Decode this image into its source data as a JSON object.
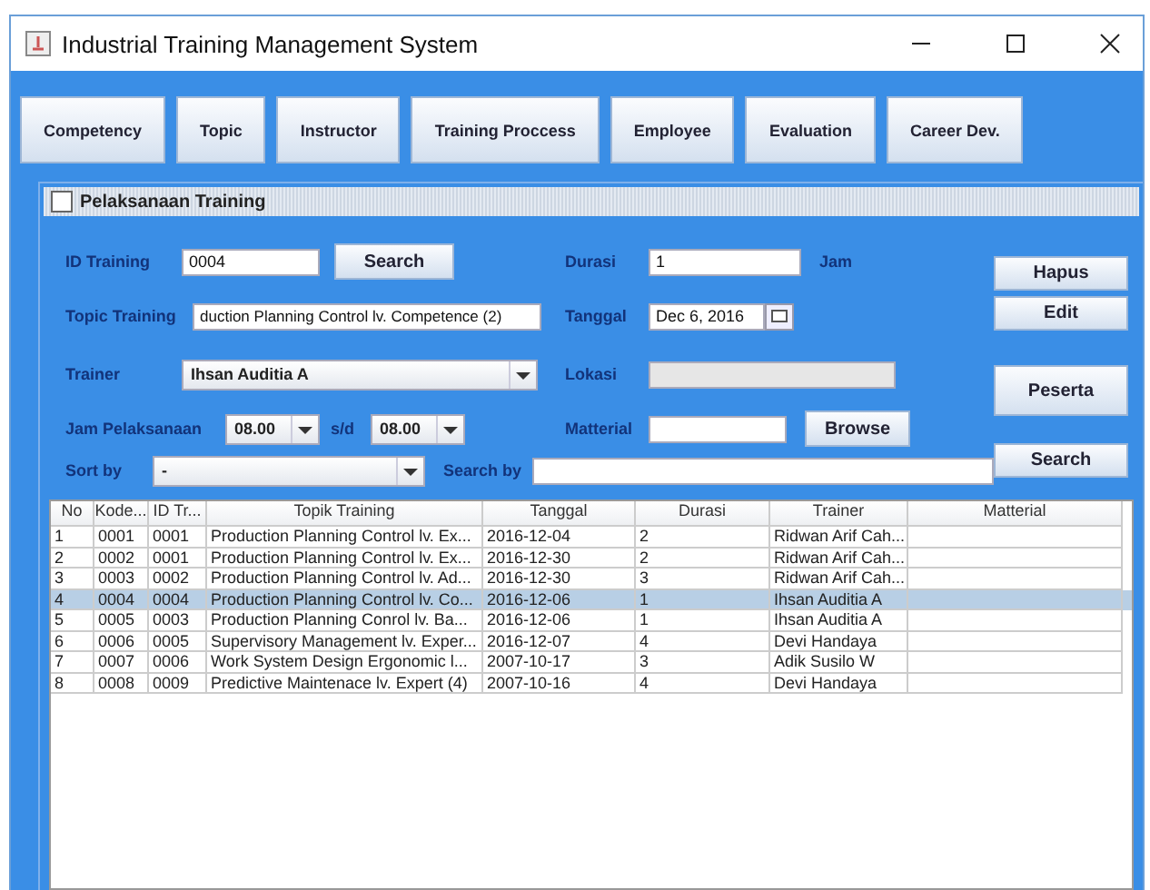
{
  "window": {
    "title": "Industrial Training Management System"
  },
  "nav_buttons": [
    "Competency",
    "Topic",
    "Instructor",
    "Training Proccess",
    "Employee",
    "Evaluation",
    "Career Dev."
  ],
  "frame": {
    "title": "Pelaksanaan Training"
  },
  "form": {
    "id_training": {
      "label": "ID Training",
      "value": "0004",
      "button": "Search"
    },
    "durasi": {
      "label": "Durasi",
      "value": "1",
      "unit": "Jam"
    },
    "topic": {
      "label": "Topic Training",
      "value": "duction Planning Control lv. Competence (2)"
    },
    "tanggal": {
      "label": "Tanggal",
      "value": "Dec 6, 2016"
    },
    "trainer": {
      "label": "Trainer",
      "value": "Ihsan Auditia A"
    },
    "lokasi": {
      "label": "Lokasi",
      "disabled": true
    },
    "jam": {
      "label": "Jam Pelaksanaan",
      "from": "08.00",
      "sep": "s/d",
      "to": "08.00"
    },
    "matterial": {
      "label": "Matterial",
      "button": "Browse"
    },
    "sort_by": {
      "label": "Sort by",
      "value": "-"
    },
    "search_by": {
      "label": "Search by"
    }
  },
  "side_buttons": [
    "Hapus",
    "Edit",
    "Peserta",
    "Search"
  ],
  "table": {
    "columns": [
      "No",
      "Kode...",
      "ID Tr...",
      "Topik Training",
      "Tanggal",
      "Durasi",
      "Trainer",
      "Matterial"
    ],
    "rows": [
      {
        "cells": [
          "1",
          "0001",
          "0001",
          "Production Planning Control lv. Ex...",
          "2016-12-04",
          "2",
          "Ridwan Arif Cah...",
          ""
        ],
        "selected": false
      },
      {
        "cells": [
          "2",
          "0002",
          "0001",
          "Production Planning Control lv. Ex...",
          "2016-12-30",
          "2",
          "Ridwan Arif Cah...",
          ""
        ],
        "selected": false
      },
      {
        "cells": [
          "3",
          "0003",
          "0002",
          "Production Planning Control lv. Ad...",
          "2016-12-30",
          "3",
          "Ridwan Arif Cah...",
          ""
        ],
        "selected": false
      },
      {
        "cells": [
          "4",
          "0004",
          "0004",
          "Production Planning Control lv. Co...",
          "2016-12-06",
          "1",
          "Ihsan Auditia A",
          ""
        ],
        "selected": true
      },
      {
        "cells": [
          "5",
          "0005",
          "0003",
          "Production Planning Conrol lv. Ba...",
          "2016-12-06",
          "1",
          "Ihsan Auditia A",
          ""
        ],
        "selected": false
      },
      {
        "cells": [
          "6",
          "0006",
          "0005",
          "Supervisory Management lv. Exper...",
          "2016-12-07",
          "4",
          "Devi Handaya",
          ""
        ],
        "selected": false
      },
      {
        "cells": [
          "7",
          "0007",
          "0006",
          "Work System Design Ergonomic l...",
          "2007-10-17",
          "3",
          "Adik Susilo W",
          ""
        ],
        "selected": false
      },
      {
        "cells": [
          "8",
          "0008",
          "0009",
          "Predictive Maintenace lv. Expert (4)",
          "2007-10-16",
          "4",
          "Devi Handaya",
          ""
        ],
        "selected": false
      }
    ]
  }
}
